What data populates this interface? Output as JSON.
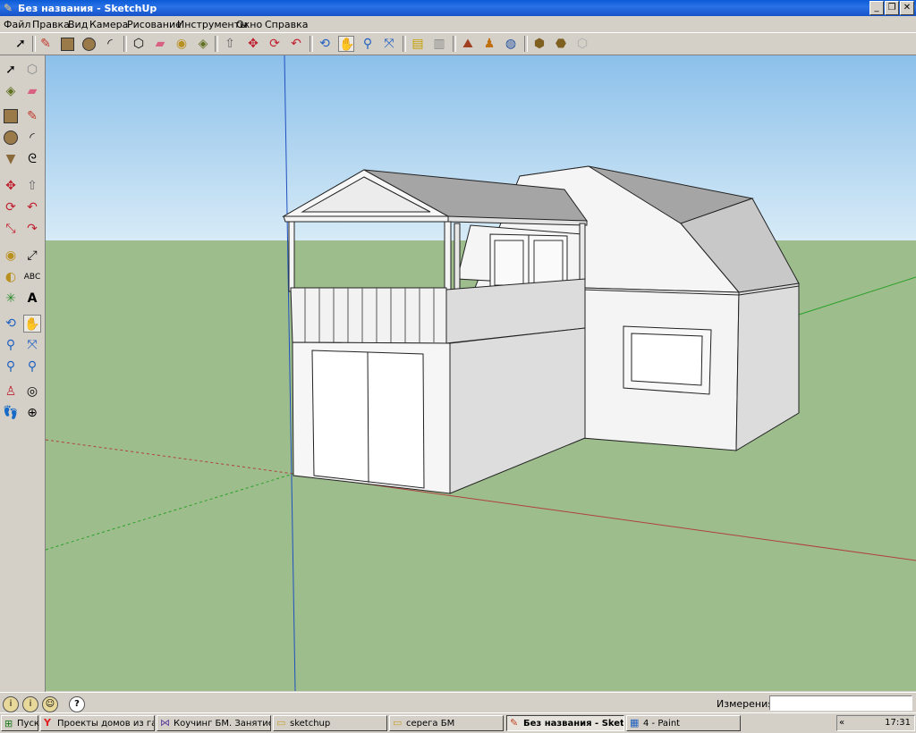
{
  "window": {
    "title": "Без названия - SketchUp",
    "min": "_",
    "max": "❐",
    "close": "✕"
  },
  "menu": [
    "Файл",
    "Правка",
    "Вид",
    "Камера",
    "Рисование",
    "Инструменты",
    "Окно",
    "Справка"
  ],
  "toolbar_icons": [
    "select-icon",
    "line-icon",
    "rectangle-icon",
    "circle-icon",
    "arc-icon",
    "make-component-icon",
    "eraser-icon",
    "tape-measure-icon",
    "paint-bucket-icon",
    "push-pull-icon",
    "move-icon",
    "rotate-icon",
    "follow-me-icon",
    "orbit-icon",
    "pan-icon",
    "zoom-icon",
    "zoom-extents-icon",
    "previous-view-icon",
    "next-view-icon",
    "get-models-icon",
    "share-model-icon",
    "add-location-icon",
    "toggle-terrain-icon",
    "get-photo-icon",
    "preview-google-earth-icon",
    "warehouse-icon",
    "model-info-icon"
  ],
  "sidebar_icons": [
    "select-icon",
    "make-component-icon",
    "paint-bucket-icon",
    "eraser-icon",
    "rectangle-icon",
    "line-icon",
    "circle-icon",
    "arc-icon",
    "polygon-icon",
    "freehand-icon",
    "move-icon",
    "push-pull-icon",
    "rotate-icon",
    "follow-me-icon",
    "scale-icon",
    "offset-icon",
    "tape-measure-icon",
    "dimension-icon",
    "protractor-icon",
    "text-icon",
    "axes-icon",
    "3d-text-icon",
    "orbit-icon",
    "pan-icon",
    "zoom-icon",
    "zoom-window-icon",
    "zoom-extents-icon",
    "previous-icon",
    "position-camera-icon",
    "look-around-icon",
    "walk-icon",
    "section-plane-icon"
  ],
  "status": {
    "measure_label": "Измерения",
    "measure_value": "",
    "help": "?"
  },
  "taskbar": {
    "start": "Пуск",
    "tasks": [
      {
        "icon": "yandex-icon",
        "label": "Проекты домов из газ...",
        "active": false
      },
      {
        "icon": "visual-studio-icon",
        "label": "Коучинг БМ. Занятие ...",
        "active": false
      },
      {
        "icon": "folder-icon",
        "label": "sketchup",
        "active": false
      },
      {
        "icon": "folder-icon",
        "label": "серега БМ",
        "active": false
      },
      {
        "icon": "sketchup-icon",
        "label": "Без названия - Sketc...",
        "active": true
      },
      {
        "icon": "paint-icon",
        "label": "4 - Paint",
        "active": false
      }
    ],
    "tray_chevron": "«",
    "clock": "17:31"
  },
  "colors": {
    "sky_top": "#8cc0ea",
    "sky_bottom": "#d7ebf7",
    "ground": "#9dbd8c",
    "wall_light": "#f2f2f2",
    "wall_shade": "#d9d9d9",
    "roof": "#a0a0a0",
    "roof_light": "#c8c8c8",
    "axis_red": "#b04040",
    "axis_green": "#2aa02a",
    "axis_blue": "#2050c0"
  }
}
